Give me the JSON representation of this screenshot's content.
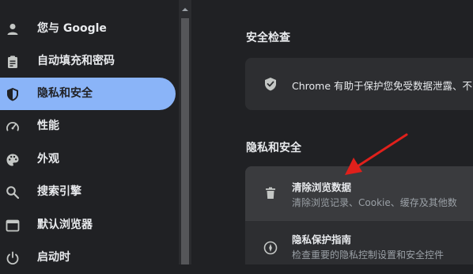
{
  "sidebar": {
    "items": [
      {
        "label": "您与 Google",
        "icon": "person-icon"
      },
      {
        "label": "自动填充和密码",
        "icon": "clipboard-icon"
      },
      {
        "label": "隐私和安全",
        "icon": "shield-icon",
        "active": true
      },
      {
        "label": "性能",
        "icon": "speedometer-icon"
      },
      {
        "label": "外观",
        "icon": "palette-icon"
      },
      {
        "label": "搜索引擎",
        "icon": "search-icon"
      },
      {
        "label": "默认浏览器",
        "icon": "browser-icon"
      },
      {
        "label": "启动时",
        "icon": "power-icon"
      }
    ]
  },
  "main": {
    "safety_check": {
      "title": "安全检查",
      "text": "Chrome 有助于保护您免受数据泄露、不"
    },
    "privacy": {
      "title": "隐私和安全",
      "rows": [
        {
          "title": "清除浏览数据",
          "subtitle": "清除浏览记录、Cookie、缓存及其他数",
          "icon": "trash-icon"
        },
        {
          "title": "隐私保护指南",
          "subtitle": "检查重要的隐私控制设置和安全控件",
          "icon": "compass-icon"
        }
      ]
    }
  },
  "colors": {
    "background": "#202124",
    "card": "#2d2e31",
    "active_item": "#8ab4f8",
    "annotation_arrow": "#e0201b"
  }
}
